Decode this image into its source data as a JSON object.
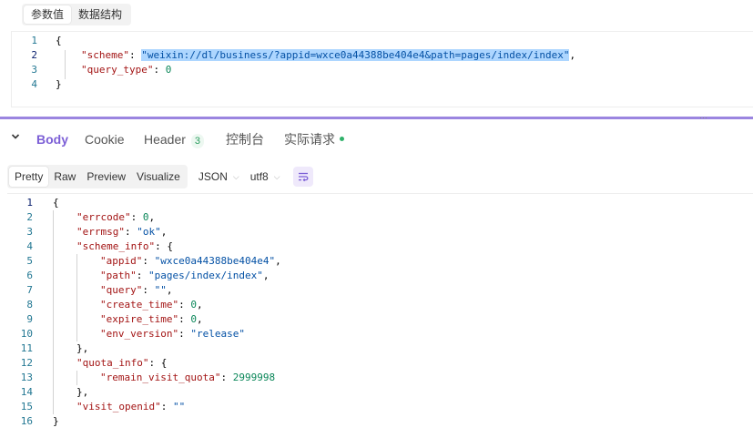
{
  "request": {
    "tabs": [
      {
        "label": "参数值",
        "active": true
      },
      {
        "label": "数据结构",
        "active": false
      }
    ],
    "code": {
      "line_numbers": [
        "1",
        "2",
        "3",
        "4"
      ],
      "lines": [
        {
          "brace": "{"
        },
        {
          "key": "\"scheme\"",
          "colon": ": ",
          "value": "\"weixin://dl/business/?appid=wxce0a44388be404e4&path=pages/index/index\"",
          "tail": ","
        },
        {
          "key": "\"query_type\"",
          "colon": ": ",
          "num": "0"
        },
        {
          "brace": "}"
        }
      ]
    }
  },
  "splitter": {
    "grip": "⋯"
  },
  "response": {
    "collapse_icon": "chevron-down",
    "tabs": [
      {
        "label": "Body",
        "active": true
      },
      {
        "label": "Cookie"
      },
      {
        "label": "Header",
        "badge": "3"
      },
      {
        "label": "控制台"
      },
      {
        "label": "实际请求",
        "status": "green-dot"
      }
    ],
    "views": [
      "Pretty",
      "Raw",
      "Preview",
      "Visualize"
    ],
    "active_view": "Pretty",
    "format": "JSON",
    "encoding": "utf8",
    "wrap_icon": "wrap-lines-icon",
    "accent": "#7c5fd6",
    "code": {
      "line_numbers": [
        "1",
        "2",
        "3",
        "4",
        "5",
        "6",
        "7",
        "8",
        "9",
        "10",
        "11",
        "12",
        "13",
        "14",
        "15",
        "16"
      ],
      "lines": [
        {
          "brace": "{"
        },
        {
          "key": "\"errcode\"",
          "colon": ": ",
          "num": "0",
          "tail": ","
        },
        {
          "key": "\"errmsg\"",
          "colon": ": ",
          "value": "\"ok\"",
          "tail": ","
        },
        {
          "key": "\"scheme_info\"",
          "colon": ": ",
          "brace": "{"
        },
        {
          "key": "\"appid\"",
          "colon": ": ",
          "value": "\"wxce0a44388be404e4\"",
          "tail": ","
        },
        {
          "key": "\"path\"",
          "colon": ": ",
          "value": "\"pages/index/index\"",
          "tail": ","
        },
        {
          "key": "\"query\"",
          "colon": ": ",
          "value": "\"\"",
          "tail": ","
        },
        {
          "key": "\"create_time\"",
          "colon": ": ",
          "num": "0",
          "tail": ","
        },
        {
          "key": "\"expire_time\"",
          "colon": ": ",
          "num": "0",
          "tail": ","
        },
        {
          "key": "\"env_version\"",
          "colon": ": ",
          "value": "\"release\""
        },
        {
          "brace": "},"
        },
        {
          "key": "\"quota_info\"",
          "colon": ": ",
          "brace": "{"
        },
        {
          "key": "\"remain_visit_quota\"",
          "colon": ": ",
          "num": "2999998"
        },
        {
          "brace": "},"
        },
        {
          "key": "\"visit_openid\"",
          "colon": ": ",
          "value": "\"\""
        },
        {
          "brace": "}"
        }
      ]
    }
  }
}
